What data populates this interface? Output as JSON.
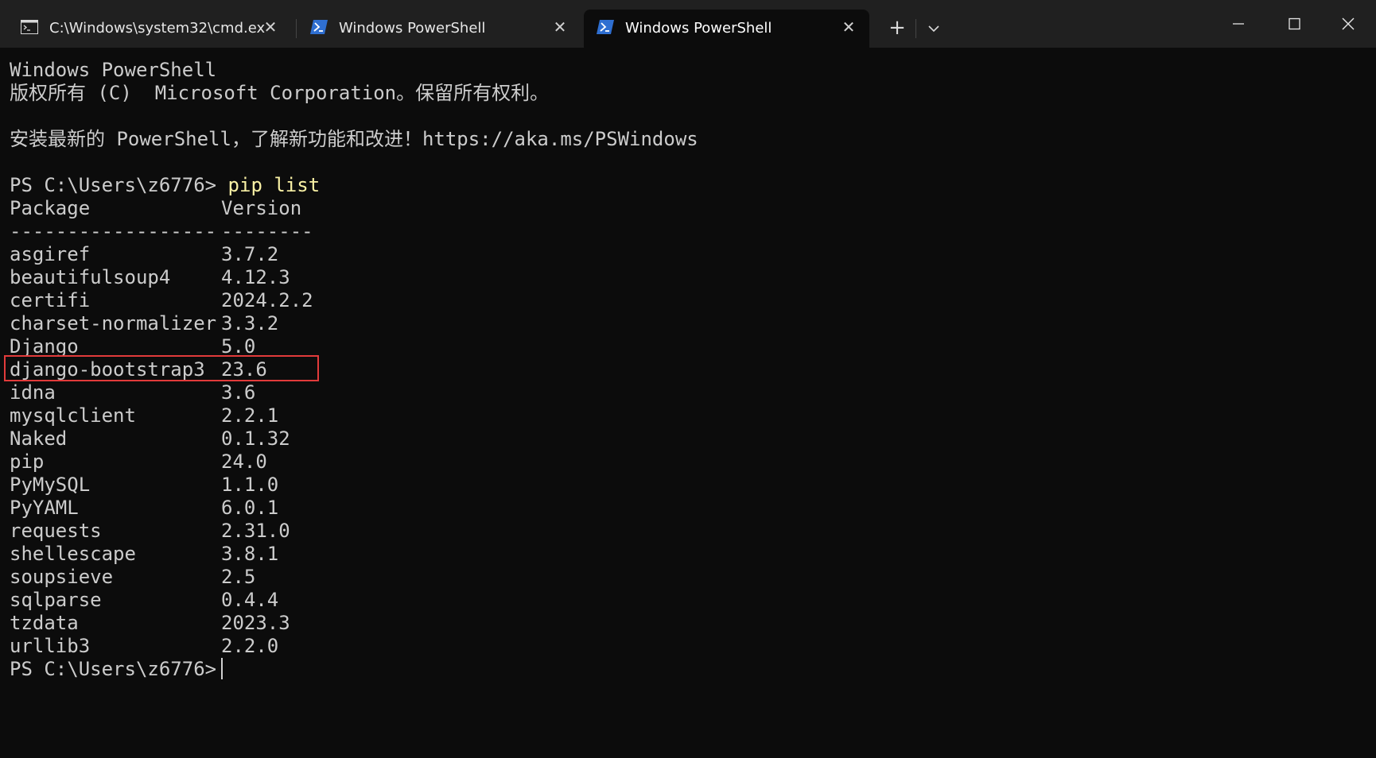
{
  "tabs": [
    {
      "label": "C:\\Windows\\system32\\cmd.ex",
      "icon": "cmd-icon",
      "active": false
    },
    {
      "label": "Windows PowerShell",
      "icon": "powershell-icon",
      "active": false
    },
    {
      "label": "Windows PowerShell",
      "icon": "powershell-icon",
      "active": true
    }
  ],
  "titlebar": {
    "new_tab_glyph": "+",
    "close_glyph": "✕"
  },
  "colors": {
    "background": "#0c0c0c",
    "titlebar": "#202020",
    "text": "#cccccc",
    "command": "#f9f1a5",
    "highlight_border": "#e23b3b",
    "powershell_icon": "#2f6fd1"
  },
  "terminal": {
    "banner_title": "Windows PowerShell",
    "copyright": "版权所有 (C)  Microsoft Corporation。保留所有权利。",
    "install_hint": "安装最新的 PowerShell，了解新功能和改进！https://aka.ms/PSWindows",
    "prompt": "PS C:\\Users\\z6776> ",
    "command": "pip list",
    "header_package": "Package",
    "header_version": "Version",
    "separator_package": "------------------",
    "separator_version": "--------",
    "packages": [
      {
        "name": "asgiref",
        "version": "3.7.2"
      },
      {
        "name": "beautifulsoup4",
        "version": "4.12.3"
      },
      {
        "name": "certifi",
        "version": "2024.2.2"
      },
      {
        "name": "charset-normalizer",
        "version": "3.3.2"
      },
      {
        "name": "Django",
        "version": "5.0"
      },
      {
        "name": "django-bootstrap3",
        "version": "23.6"
      },
      {
        "name": "idna",
        "version": "3.6"
      },
      {
        "name": "mysqlclient",
        "version": "2.2.1"
      },
      {
        "name": "Naked",
        "version": "0.1.32"
      },
      {
        "name": "pip",
        "version": "24.0"
      },
      {
        "name": "PyMySQL",
        "version": "1.1.0"
      },
      {
        "name": "PyYAML",
        "version": "6.0.1"
      },
      {
        "name": "requests",
        "version": "2.31.0"
      },
      {
        "name": "shellescape",
        "version": "3.8.1"
      },
      {
        "name": "soupsieve",
        "version": "2.5"
      },
      {
        "name": "sqlparse",
        "version": "0.4.4"
      },
      {
        "name": "tzdata",
        "version": "2023.3"
      },
      {
        "name": "urllib3",
        "version": "2.2.0"
      }
    ],
    "final_prompt": "PS C:\\Users\\z6776> "
  }
}
